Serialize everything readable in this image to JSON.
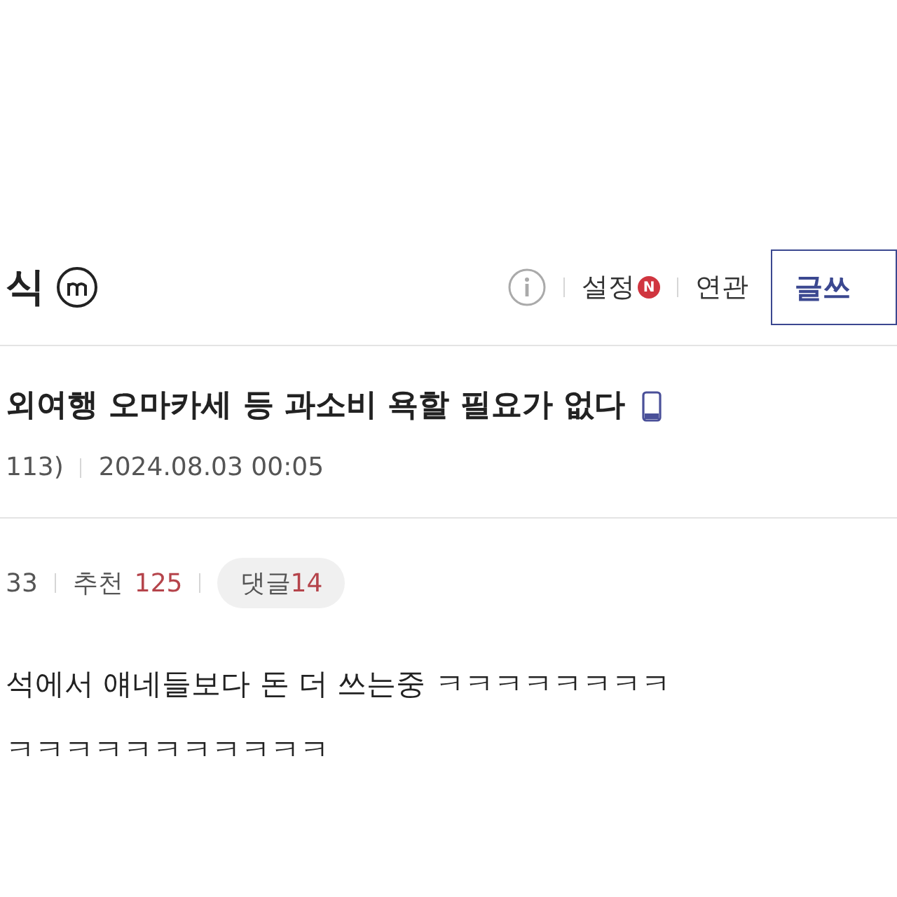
{
  "header": {
    "title": "식",
    "links": [
      {
        "label": "설정",
        "new_badge": "N"
      },
      {
        "label": "연관"
      }
    ],
    "write_button": "글쓰"
  },
  "post": {
    "title": "외여행 오마카세 등 과소비 욕할 필요가 없다",
    "mobile": true,
    "author_tail": "113)",
    "date": "2024.08.03 00:05",
    "views": "33",
    "recommend_label": "추천",
    "recommend": "125",
    "comments_label": "댓글",
    "comments": "14",
    "body": [
      "석에서 얘네들보다 돈 더 쓰는중 ㅋㅋㅋㅋㅋㅋㅋㅋ",
      "ㅋㅋㅋㅋㅋㅋㅋㅋㅋㅋㅋ"
    ]
  }
}
